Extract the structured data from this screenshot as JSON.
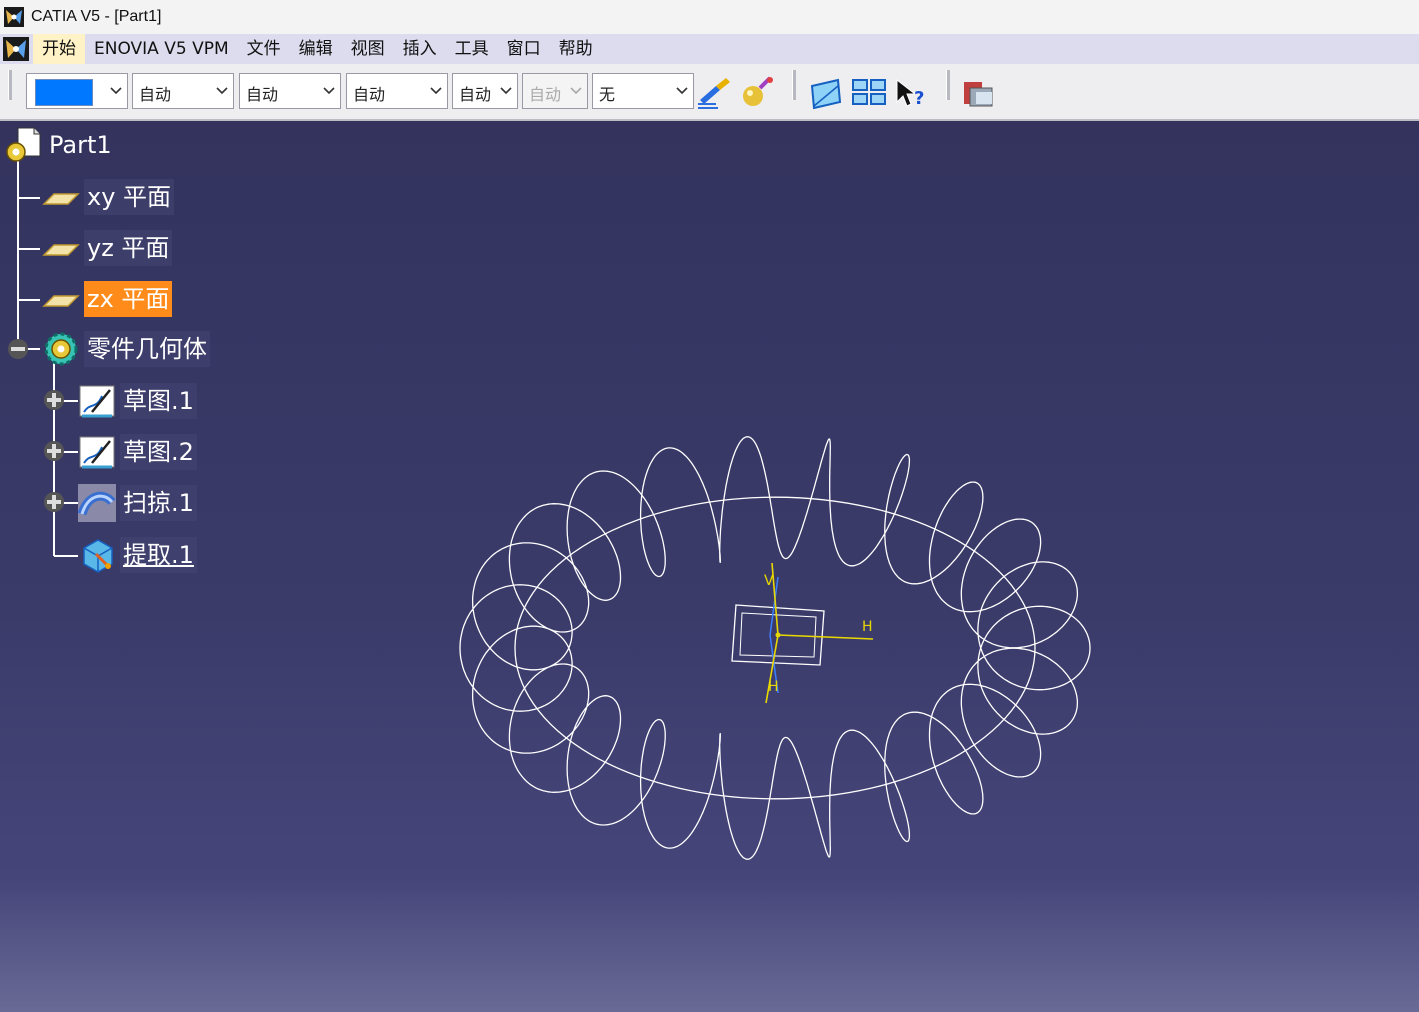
{
  "window": {
    "title": "CATIA V5 - [Part1]",
    "app_icon": "catia-logo-icon"
  },
  "menubar": {
    "items": [
      {
        "label": "开始",
        "active": true
      },
      {
        "label": "ENOVIA V5 VPM",
        "active": false
      },
      {
        "label": "文件",
        "active": false
      },
      {
        "label": "编辑",
        "active": false
      },
      {
        "label": "视图",
        "active": false
      },
      {
        "label": "插入",
        "active": false
      },
      {
        "label": "工具",
        "active": false
      },
      {
        "label": "窗口",
        "active": false
      },
      {
        "label": "帮助",
        "active": false
      }
    ]
  },
  "toolbar": {
    "color_combo": {
      "value_color": "#0078ff"
    },
    "linetype_combo": {
      "value": "自动"
    },
    "thickness_combo": {
      "value": "自动"
    },
    "pointstyle_combo": {
      "value": "自动"
    },
    "layer_combo": {
      "value": "自动"
    },
    "disabled_combo": {
      "value": "自动"
    },
    "render_combo": {
      "value": "无"
    },
    "icons": [
      "painter-brush-icon",
      "apply-material-icon",
      "sketch-icon",
      "multi-view-icon",
      "whats-this-help-icon",
      "catalog-browser-icon"
    ]
  },
  "tree": {
    "root": {
      "label": "Part1",
      "icon": "part-document-icon"
    },
    "planes": [
      {
        "label": "xy 平面",
        "icon": "plane-icon",
        "selected": false
      },
      {
        "label": "yz 平面",
        "icon": "plane-icon",
        "selected": false
      },
      {
        "label": "zx 平面",
        "icon": "plane-icon",
        "selected": true
      }
    ],
    "body": {
      "label": "零件几何体",
      "icon": "part-body-gear-icon",
      "expanded": true
    },
    "children": [
      {
        "label": "草图.1",
        "icon": "sketch-icon",
        "expandable": true
      },
      {
        "label": "草图.2",
        "icon": "sketch-icon",
        "expandable": true
      },
      {
        "label": "扫掠.1",
        "icon": "sweep-icon",
        "expandable": true
      },
      {
        "label": "提取.1",
        "icon": "extract-icon",
        "expandable": false,
        "underlined": true
      }
    ]
  },
  "viewport": {
    "background_top": "#33335e",
    "background_bottom": "#6a6a96",
    "geometry_color": "#ffffff",
    "axis_color": "#e8d800",
    "axis_labels": {
      "x": "H",
      "y": "V",
      "z": "H"
    }
  }
}
